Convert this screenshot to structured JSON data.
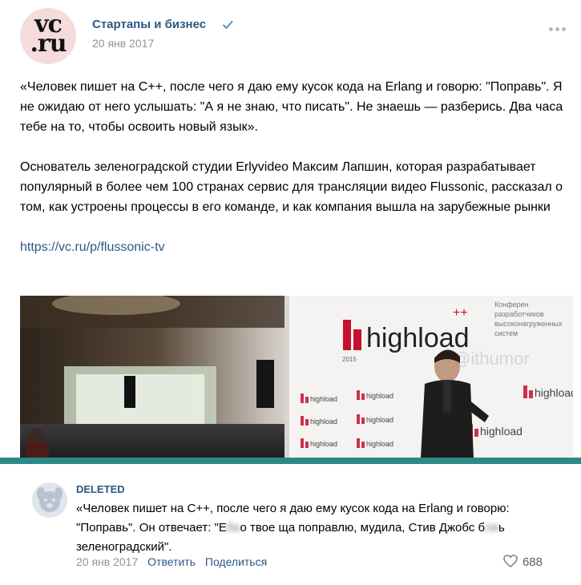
{
  "post": {
    "group_name": "Стартапы и бизнес",
    "date": "20 янв 2017",
    "avatar_logo": [
      "vc",
      ".ru"
    ],
    "paragraphs": [
      "«Человек пишет на C++, после чего я даю ему кусок кода на Erlang и говорю: \"Поправь\". Я не ожидаю от него услышать: \"А я не знаю, что писать\". Не знаешь — разберись. Два часа тебе на то, чтобы освоить новый язык».",
      "Основатель зеленоградской студии Erlyvideo Максим Лапшин, которая разрабатывает популярный в более чем 100 странах сервис для трансляции видео Flussonic, рассказал о том, как устроены процессы в его команде, и как компания вышла на зарубежные рынки"
    ],
    "link": "https://vc.ru/p/flussonic-tv"
  },
  "photo": {
    "brand": "highload",
    "brand_plus": "++",
    "year": "2015",
    "side_text": [
      "Конферен",
      "разработчиков",
      "высоконагруженных",
      "систем"
    ],
    "watermark": "@ithumor"
  },
  "comment": {
    "author": "DELETED",
    "text_before_blur_1": "«Человек пишет на C++, после чего я даю ему кусок кода на Erlang и говорю: \"Поправь\". Он отвечает: \"Е",
    "blur_1": "ба",
    "text_between": "о твое ща поправлю, мудила, Стив Джобс б",
    "blur_2": "ля",
    "text_after": "ь зеленоградский\".",
    "date": "20 янв 2017",
    "reply_label": "Ответить",
    "share_label": "Поделиться",
    "likes": "688"
  },
  "colors": {
    "link": "#2a5885",
    "muted": "#939393",
    "accent_bar": "#2b8a86",
    "highload_red": "#c8102e"
  }
}
